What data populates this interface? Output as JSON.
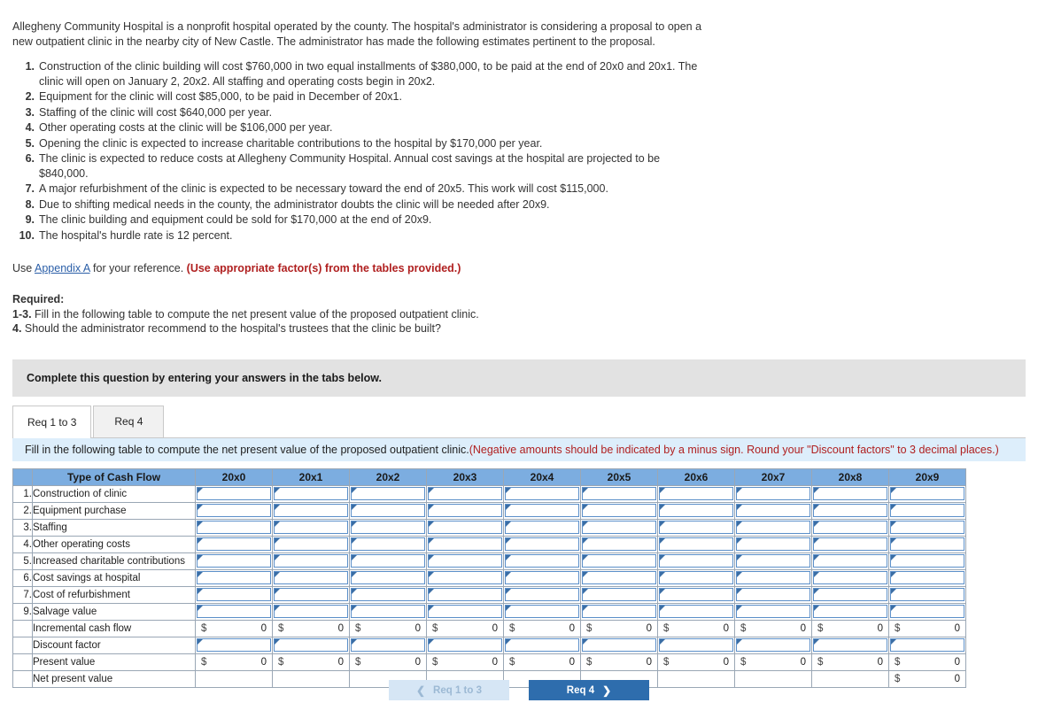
{
  "problem": {
    "intro": "Allegheny Community Hospital is a nonprofit hospital operated by the county. The hospital's administrator is considering a proposal to open a new outpatient clinic in the nearby city of New Castle. The administrator has made the following estimates pertinent to the proposal.",
    "facts": [
      {
        "num": "1.",
        "text": "Construction of the clinic building will cost $760,000 in two equal installments of $380,000, to be paid at the end of 20x0 and 20x1. The clinic will open on January 2, 20x2. All staffing and operating costs begin in 20x2."
      },
      {
        "num": "2.",
        "text": "Equipment for the clinic will cost $85,000, to be paid in December of 20x1."
      },
      {
        "num": "3.",
        "text": "Staffing of the clinic will cost $640,000 per year."
      },
      {
        "num": "4.",
        "text": "Other operating costs at the clinic will be $106,000 per year."
      },
      {
        "num": "5.",
        "text": "Opening the clinic is expected to increase charitable contributions to the hospital by $170,000 per year."
      },
      {
        "num": "6.",
        "text": "The clinic is expected to reduce costs at Allegheny Community Hospital. Annual cost savings at the hospital are projected to be $840,000."
      },
      {
        "num": "7.",
        "text": "A major refurbishment of the clinic is expected to be necessary toward the end of 20x5. This work will cost $115,000."
      },
      {
        "num": "8.",
        "text": "Due to shifting medical needs in the county, the administrator doubts the clinic will be needed after 20x9."
      },
      {
        "num": "9.",
        "text": "The clinic building and equipment could be sold for $170,000 at the end of 20x9."
      },
      {
        "num": "10.",
        "text": "The hospital's hurdle rate is 12 percent."
      }
    ],
    "appendix_prefix": "Use ",
    "appendix_link": "Appendix A",
    "appendix_suffix": " for your reference. ",
    "appendix_note": "(Use appropriate factor(s) from the tables provided.)",
    "required_label": "Required:",
    "req_1_3_num": "1-3.",
    "req_1_3_text": " Fill in the following table to compute the net present value of the proposed outpatient clinic.",
    "req_4_num": "4.",
    "req_4_text": " Should the administrator recommend to the hospital's trustees that the clinic be built?"
  },
  "banner": {
    "text": "Complete this question by entering your answers in the tabs below."
  },
  "tabs": [
    {
      "label": "Req 1 to 3",
      "active": true
    },
    {
      "label": "Req 4",
      "active": false
    }
  ],
  "instruction": {
    "black_text": "Fill in the following table to compute the net present value of the proposed outpatient clinic. ",
    "red_text": "(Negative amounts should be indicated by a minus sign. Round your \"Discount factors\" to 3 decimal places.)"
  },
  "table": {
    "header_num": "",
    "header_label": "Type of Cash Flow",
    "years": [
      "20x0",
      "20x1",
      "20x2",
      "20x3",
      "20x4",
      "20x5",
      "20x6",
      "20x7",
      "20x8",
      "20x9"
    ],
    "rows": [
      {
        "num": "1.",
        "label": "Construction of clinic",
        "kind": "input"
      },
      {
        "num": "2.",
        "label": "Equipment purchase",
        "kind": "input"
      },
      {
        "num": "3.",
        "label": "Staffing",
        "kind": "input"
      },
      {
        "num": "4.",
        "label": "Other operating costs",
        "kind": "input"
      },
      {
        "num": "5.",
        "label": "Increased charitable contributions",
        "kind": "input"
      },
      {
        "num": "6.",
        "label": "Cost savings at hospital",
        "kind": "input"
      },
      {
        "num": "7.",
        "label": "Cost of refurbishment",
        "kind": "input"
      },
      {
        "num": "9.",
        "label": "Salvage value",
        "kind": "input"
      },
      {
        "num": "",
        "label": "Incremental cash flow",
        "kind": "value",
        "currency": "$",
        "values": [
          "0",
          "0",
          "0",
          "0",
          "0",
          "0",
          "0",
          "0",
          "0",
          "0"
        ]
      },
      {
        "num": "",
        "label": "Discount factor",
        "kind": "input"
      },
      {
        "num": "",
        "label": "Present value",
        "kind": "value",
        "currency": "$",
        "values": [
          "0",
          "0",
          "0",
          "0",
          "0",
          "0",
          "0",
          "0",
          "0",
          "0"
        ]
      },
      {
        "num": "",
        "label": "Net present value",
        "kind": "npv",
        "currency": "$",
        "npv_value": "0"
      }
    ]
  },
  "nav": {
    "prev_label": "Req 1 to 3",
    "prev_icon": "chevron-left-icon",
    "next_label": "Req 4",
    "next_icon": "chevron-right-icon"
  },
  "colors": {
    "header_blue": "#7cade0",
    "instruction_bg": "#ddeefb",
    "banner_bg": "#e2e2e2",
    "accent_red": "#b02020",
    "link_blue": "#2b5fa8",
    "next_button": "#2e6dad",
    "prev_button": "#d6e6f5"
  }
}
